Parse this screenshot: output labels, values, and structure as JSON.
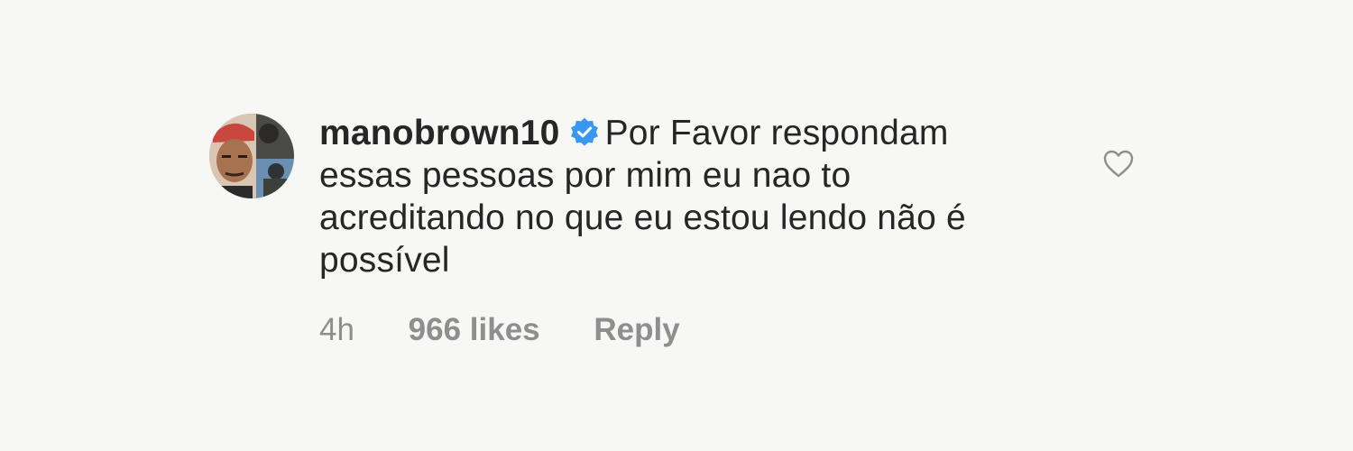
{
  "comment": {
    "username": "manobrown10",
    "verified": true,
    "text": "Por Favor respondam essas pessoas por mim eu nao to acreditando no que eu estou lendo não é possível",
    "time": "4h",
    "likes": "966 likes",
    "reply_label": "Reply"
  },
  "icons": {
    "verified": "verified-badge-icon",
    "like": "heart-outline-icon"
  },
  "colors": {
    "verified_badge": "#3897f0",
    "text": "#262626",
    "meta": "#8e8e8e"
  }
}
